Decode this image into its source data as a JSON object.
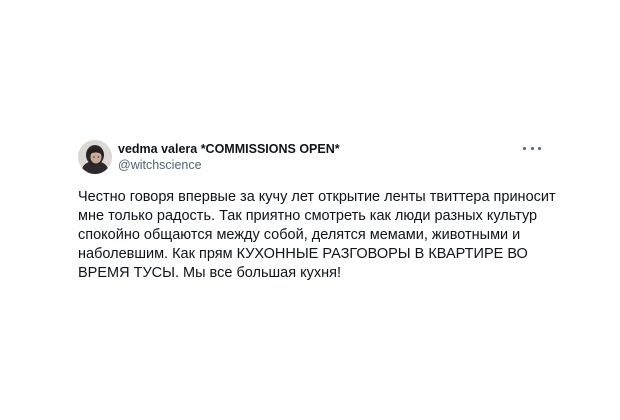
{
  "tweet": {
    "author": {
      "display_name": "vedma valera *COMMISSIONS OPEN*",
      "handle": "@witchscience",
      "avatar_icon": "avatar-photo"
    },
    "more_icon": "more-options-icon",
    "text_lines": [
      "Честно говоря впервые за кучу лет открытие ленты твиттера приносит",
      "мне только радость. Так приятно смотреть как люди разных культур",
      "спокойно общаются между собой, делятся мемами, животными и",
      "наболевшим. Как прям КУХОННЫЕ РАЗГОВОРЫ В КВАРТИРЕ ВО",
      "ВРЕМЯ ТУСЫ. Мы все большая кухня!"
    ]
  }
}
